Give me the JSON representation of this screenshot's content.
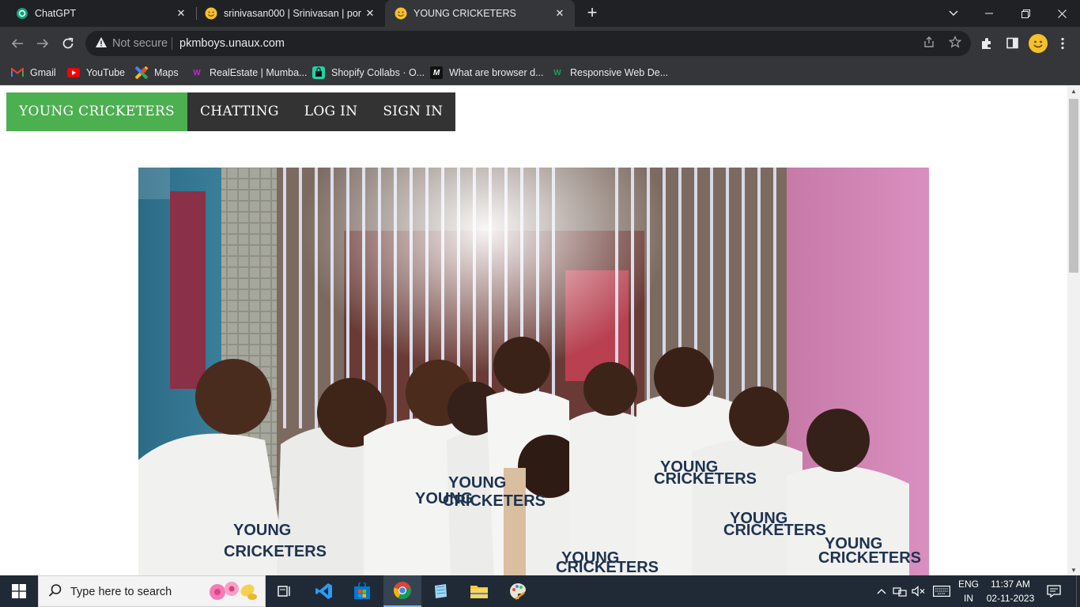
{
  "browser": {
    "tabs": [
      {
        "title": "ChatGPT",
        "favicon": "chatgpt-icon",
        "active": false
      },
      {
        "title": "srinivasan000 | Srinivasan | portfolio",
        "favicon": "smiley-icon",
        "active": false
      },
      {
        "title": "YOUNG CRICKETERS",
        "favicon": "smiley-icon",
        "active": true
      }
    ],
    "new_tab": "+",
    "address": {
      "security_label": "Not secure",
      "url": "pkmboys.unaux.com"
    },
    "bookmarks": [
      {
        "label": "Gmail",
        "icon": "gmail-icon"
      },
      {
        "label": "YouTube",
        "icon": "youtube-icon"
      },
      {
        "label": "Maps",
        "icon": "maps-icon"
      },
      {
        "label": "RealEstate | Mumba...",
        "icon": "realestate-icon"
      },
      {
        "label": "Shopify Collabs · O...",
        "icon": "shopify-icon"
      },
      {
        "label": "What are browser d...",
        "icon": "medium-icon"
      },
      {
        "label": "Responsive Web De...",
        "icon": "webflow-icon"
      }
    ]
  },
  "site": {
    "nav": [
      {
        "label": "YOUNG CRICKETERS",
        "active": true
      },
      {
        "label": "CHATTING",
        "active": false
      },
      {
        "label": "LOG IN",
        "active": false
      },
      {
        "label": "SIGN IN",
        "active": false
      }
    ],
    "colors": {
      "nav_bg": "#333333",
      "nav_active": "#4caf50"
    }
  },
  "taskbar": {
    "search_placeholder": "Type here to search",
    "lang_top": "ENG",
    "lang_bottom": "IN",
    "time": "11:37 AM",
    "date": "02-11-2023"
  }
}
